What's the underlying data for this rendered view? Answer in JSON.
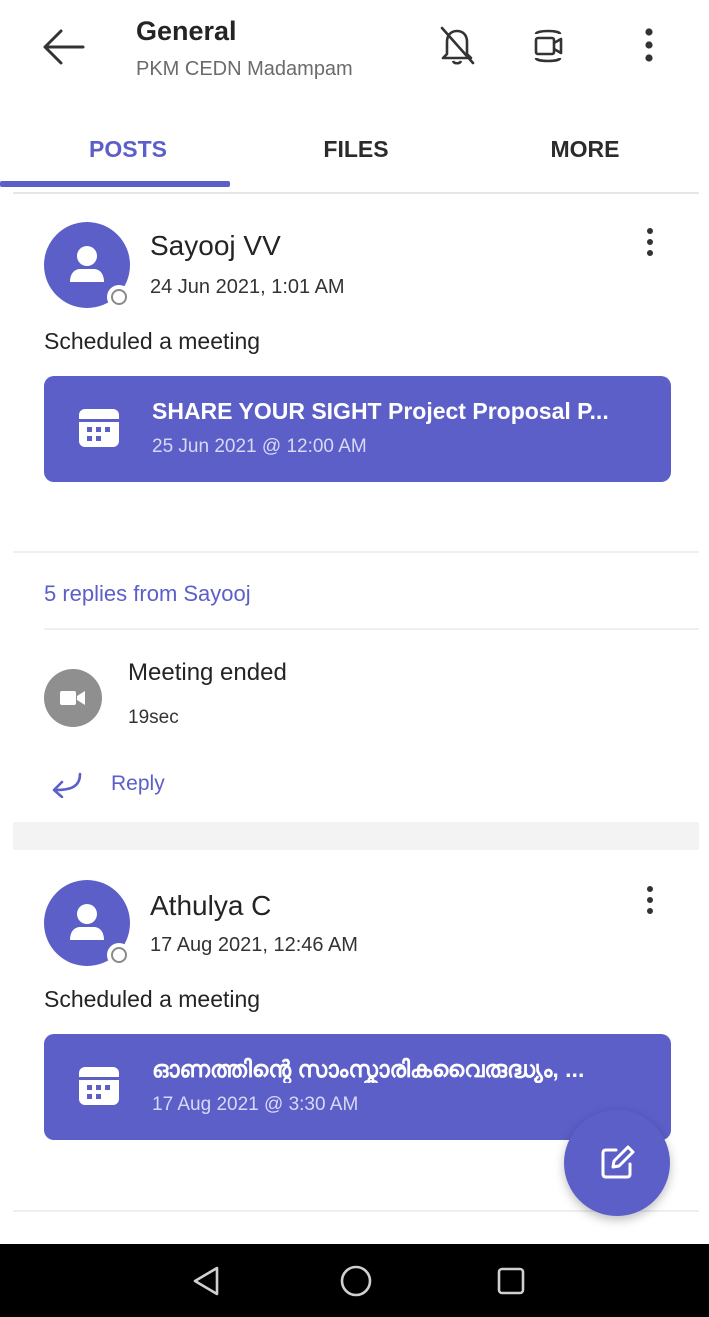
{
  "header": {
    "title": "General",
    "subtitle": "PKM CEDN Madampam",
    "icons": [
      "back-arrow-icon",
      "bell-off-icon",
      "meet-now-icon",
      "more-vertical-icon"
    ]
  },
  "tabs": [
    {
      "label": "POSTS",
      "active": true
    },
    {
      "label": "FILES",
      "active": false
    },
    {
      "label": "MORE",
      "active": false
    }
  ],
  "posts": [
    {
      "author": "Sayooj VV",
      "timestamp": "24 Jun 2021, 1:01 AM",
      "text": "Scheduled a meeting",
      "meeting": {
        "title": "SHARE YOUR SIGHT Project Proposal P...",
        "date": "25 Jun 2021 @ 12:00 AM"
      },
      "replies_link": "5 replies from Sayooj",
      "reply": {
        "title": "Meeting ended",
        "duration": "19sec"
      },
      "reply_action": "Reply"
    },
    {
      "author": "Athulya C",
      "timestamp": "17 Aug 2021, 12:46 AM",
      "text": "Scheduled a meeting",
      "meeting": {
        "title": "ഓണത്തിന്റെ സാംസ്കാരികവൈരുദ്ധ്യം, ...",
        "date": "17 Aug 2021 @ 3:30 AM"
      }
    }
  ],
  "colors": {
    "accent": "#5b5fc7",
    "text": "#242424",
    "muted": "#6b6b6b",
    "navbar": "#000000"
  },
  "fab": {
    "icon": "compose-icon"
  },
  "system_nav": {
    "icons": [
      "nav-back-icon",
      "nav-home-icon",
      "nav-recents-icon"
    ]
  }
}
